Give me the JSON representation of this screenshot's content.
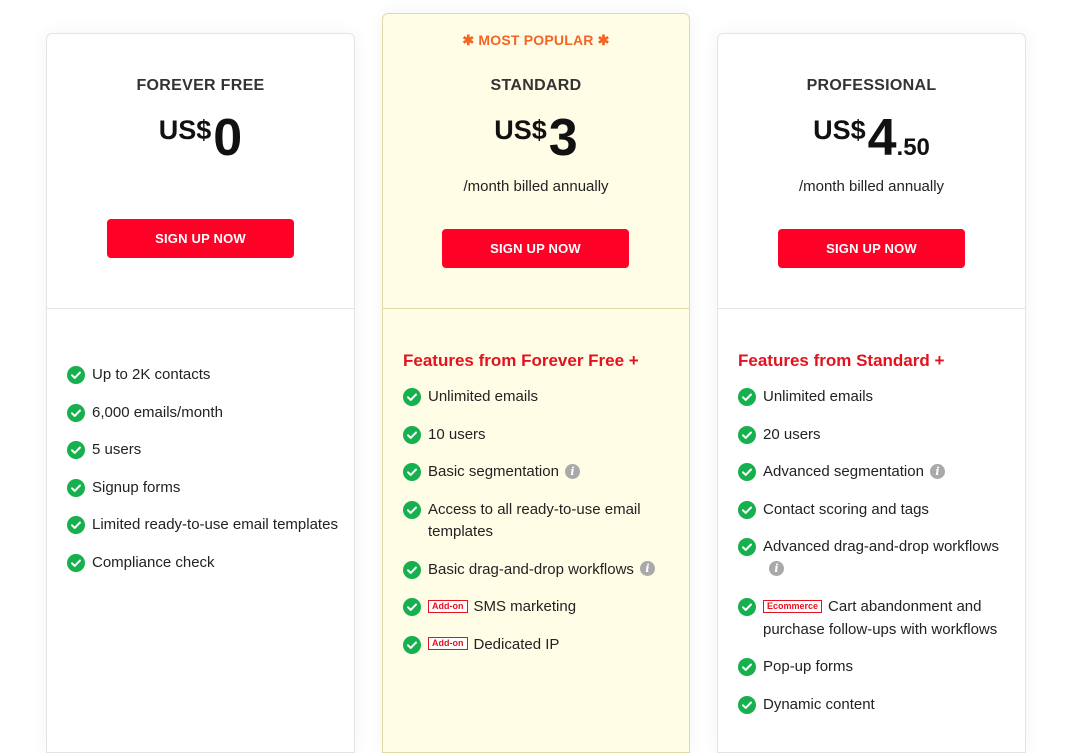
{
  "plans": {
    "free": {
      "name": "FOREVER FREE",
      "currency": "US$",
      "amount": "0",
      "button": "SIGN UP NOW",
      "features": [
        "Up to 2K contacts",
        "6,000 emails/month",
        "5 users",
        "Signup forms",
        "Limited ready-to-use email templates",
        "Compliance check"
      ]
    },
    "standard": {
      "badge": "✱ MOST POPULAR ✱",
      "name": "STANDARD",
      "currency": "US$",
      "amount": "3",
      "billed": "/month billed annually",
      "button": "SIGN UP NOW",
      "features_heading": "Features from Forever Free +",
      "features": [
        "Unlimited emails",
        "10 users",
        "Basic segmentation",
        "Access to all ready-to-use email templates",
        "Basic drag-and-drop workflows",
        "SMS marketing",
        "Dedicated IP"
      ],
      "addon_label": "Add-on"
    },
    "professional": {
      "name": "PROFESSIONAL",
      "currency": "US$",
      "amount": "4",
      "amount_decimal": ".50",
      "billed": "/month billed annually",
      "button": "SIGN UP NOW",
      "features_heading": "Features from Standard +",
      "features": [
        "Unlimited emails",
        "20 users",
        "Advanced segmentation",
        "Contact scoring and tags",
        "Advanced drag-and-drop workflows",
        "Cart abandonment and purchase follow-ups with workflows",
        "Pop-up forms",
        "Dynamic content"
      ],
      "ecommerce_label": "Ecommerce"
    }
  },
  "icons": {
    "check": "check-circle-icon",
    "info": "info-icon"
  },
  "colors": {
    "accent_red": "#ff0026",
    "heading_red": "#e2131f",
    "popular_orange": "#f26522",
    "check_green": "#16b04e",
    "standard_bg": "#fffde6"
  }
}
